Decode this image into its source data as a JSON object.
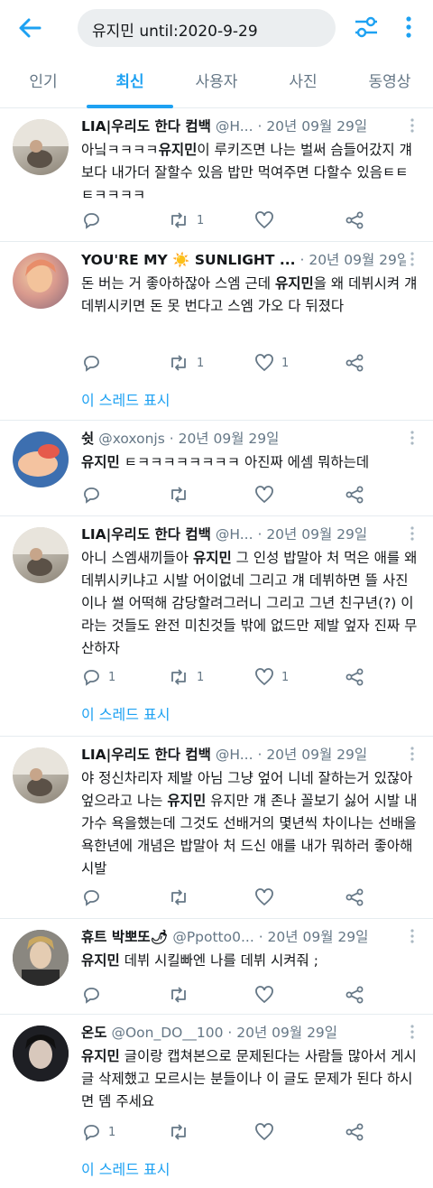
{
  "search": {
    "query": "유지민 until:2020-9-29"
  },
  "tabs": [
    "인기",
    "최신",
    "사용자",
    "사진",
    "동영상"
  ],
  "active_tab": "최신",
  "thread_link_label": "이 스레드 표시",
  "tweets": [
    {
      "name": "LIA|우리도 한다 컴백",
      "handle": "@H...",
      "date": "· 20년 09월 29일",
      "text_pre": "아닠ㅋㅋㅋㅋ",
      "text_bold": "유지민",
      "text_post": "이 루키즈면 나는 벌써 슴들어갔지 걔 보다 내가더 잘할수 있음 밥만 먹여주면 다할수 있음ㅌㅌㅌㅋㅋㅋㅋ",
      "reply_count": "",
      "retweet_count": "1",
      "like_count": ""
    },
    {
      "name": "YOU'RE MY ☀️ SUNLIGHT ...",
      "handle": "",
      "date": "· 20년 09월 29일",
      "text_pre": "돈 버는 거 좋아하잖아 스엠 근데 ",
      "text_bold": "유지민",
      "text_post": "을 왜 데뷔시켜 걔 데뷔시키면 돈 못 번다고 스엠 가오 다 뒤졌다",
      "reply_count": "",
      "retweet_count": "1",
      "like_count": "1"
    },
    {
      "name": "쉿",
      "handle": "@xoxonjs",
      "date": "· 20년 09월 29일",
      "text_pre": "",
      "text_bold": "유지민",
      "text_post": " ㅌㅋㅋㅋㅋㅋㅋㅋㅋ 아진짜 에셈 뭐하는데",
      "reply_count": "",
      "retweet_count": "",
      "like_count": ""
    },
    {
      "name": "LIA|우리도 한다 컴백",
      "handle": "@H...",
      "date": "· 20년 09월 29일",
      "text_pre": "아니 스엠새끼들아 ",
      "text_bold": "유지민",
      "text_post": " 그 인성 밥말아 처 먹은 애를 왜 데뷔시키냐고 시발 어이없네 그리고 걔 데뷔하면 뜰 사진이나 썰 어떡해 감당할려그러니 그리고 그년 친구년(?) 이라는 것들도 완전 미친것들 밖에 없드만 제발 엎자 진짜 무산하자",
      "reply_count": "1",
      "retweet_count": "1",
      "like_count": "1"
    },
    {
      "name": "LIA|우리도 한다 컴백",
      "handle": "@H...",
      "date": "· 20년 09월 29일",
      "text_pre": "야 정신차리자 제발 아님 그냥 엎어 니네 잘하는거 있잖아 엎으라고 나는 ",
      "text_bold": "유지민",
      "text_post": " 유지만 걔 존나 꼴보기 싫어 시발 내가수 욕을했는데 그것도 선배거의 몇년씩 차이나는 선배을 욕한년에 개념은 밥말아 처 드신 애를 내가 뭐하러 좋아해 시발",
      "reply_count": "",
      "retweet_count": "",
      "like_count": ""
    },
    {
      "name": "휴트 박뽀또🌶",
      "handle": "@Ppotto0...",
      "date": "· 20년 09월 29일",
      "text_pre": "",
      "text_bold": "유지민",
      "text_post": " 데뷔 시킬빠엔 나를 데뷔 시켜줘 ;",
      "reply_count": "",
      "retweet_count": "",
      "like_count": ""
    },
    {
      "name": "온도",
      "handle": "@Oon_DO__100",
      "date": "· 20년 09월 29일",
      "text_pre": "",
      "text_bold": "유지민",
      "text_post": " 글이랑 캡쳐본으로 문제된다는 사람들 많아서 게시글 삭제했고 모르시는 분들이나 이 글도 문제가 된다 하시면 뎀 주세요",
      "reply_count": "1",
      "retweet_count": "",
      "like_count": ""
    }
  ],
  "colors": {
    "accent": "#1da1f2",
    "muted": "#657786",
    "text": "#14171a"
  }
}
